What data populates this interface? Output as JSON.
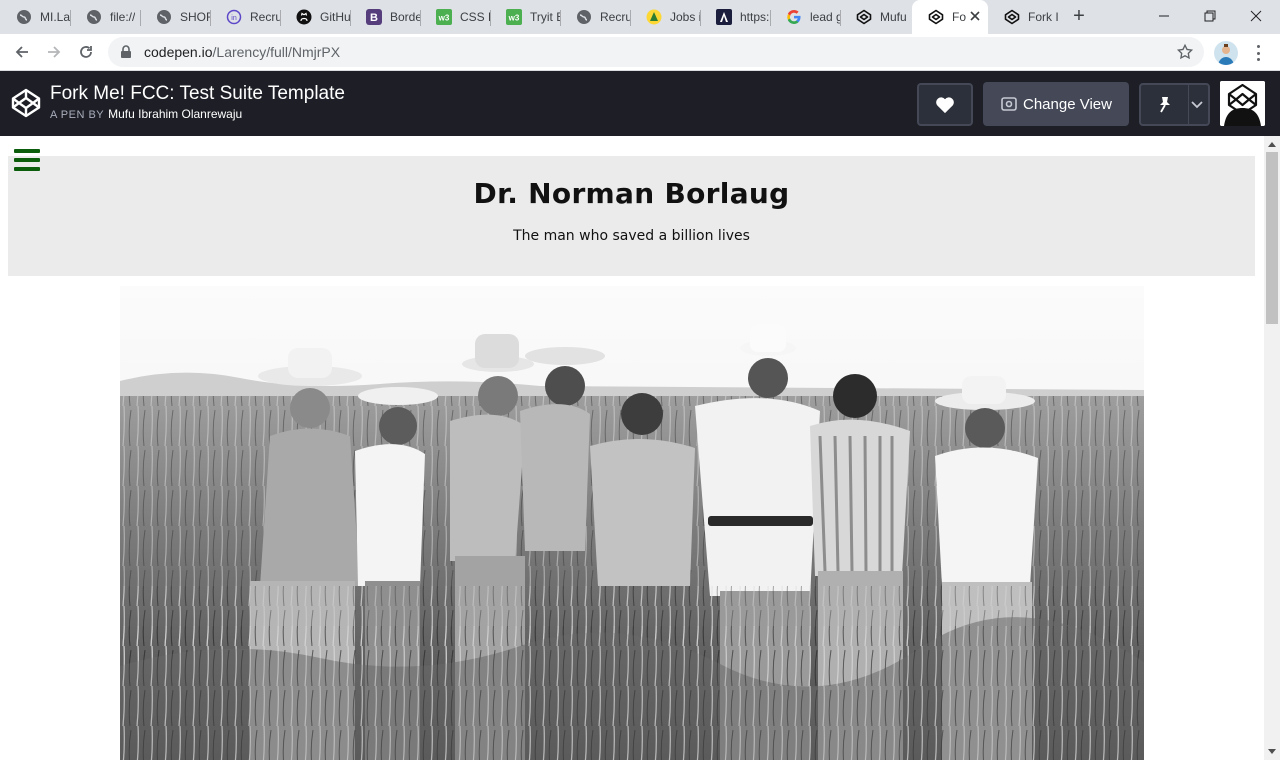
{
  "browser": {
    "tabs": [
      {
        "title": "MI.La",
        "icon": "globe-icon"
      },
      {
        "title": "file://",
        "icon": "globe-icon"
      },
      {
        "title": "SHOF",
        "icon": "globe-icon"
      },
      {
        "title": "Recru",
        "icon": "recruit-icon"
      },
      {
        "title": "GitHu",
        "icon": "github-icon"
      },
      {
        "title": "Borde",
        "icon": "bootstrap-icon"
      },
      {
        "title": "CSS F",
        "icon": "w3-icon"
      },
      {
        "title": "Tryit E",
        "icon": "w3-icon"
      },
      {
        "title": "Recru",
        "icon": "globe-icon"
      },
      {
        "title": "Jobs i",
        "icon": "jobs-icon"
      },
      {
        "title": "https:",
        "icon": "angular-icon"
      },
      {
        "title": "lead g",
        "icon": "google-icon"
      },
      {
        "title": "Mufu",
        "icon": "codepen-icon"
      },
      {
        "title": "Fo",
        "icon": "codepen-icon",
        "active": true
      },
      {
        "title": "Fork I",
        "icon": "codepen-icon"
      }
    ],
    "new_tab_label": "+",
    "url_domain": "codepen.io",
    "url_path": "/Larency/full/NmjrPX"
  },
  "codepen": {
    "title": "Fork Me! FCC: Test Suite Template",
    "byline_prefix": "A PEN BY",
    "author": "Mufu Ibrahim Olanrewaju",
    "change_view_label": "Change View"
  },
  "page": {
    "heading": "Dr. Norman Borlaug",
    "subheading": "The man who saved a billion lives"
  },
  "colors": {
    "codepen_header": "#1e1f26",
    "hero_bg": "#ebebeb",
    "hamburger": "#0b5d0b"
  }
}
